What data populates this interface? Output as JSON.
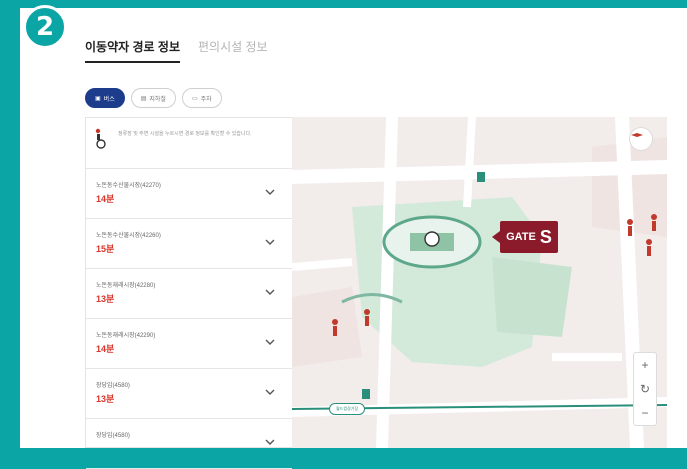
{
  "step_badge": "2",
  "tabs": [
    {
      "label": "이동약자 경로 정보",
      "active": true
    },
    {
      "label": "편의시설 정보",
      "active": false
    }
  ],
  "transport_chips": [
    {
      "label": "버스",
      "icon": "bus-icon",
      "active": true
    },
    {
      "label": "지하철",
      "icon": "subway-icon",
      "active": false
    },
    {
      "label": "주차",
      "icon": "car-icon",
      "active": false
    }
  ],
  "notice": {
    "text": "정류장 및 주변 시설을 누르시면 경로 정보를 확인할 수 있습니다."
  },
  "routes": [
    {
      "name": "노돈동수산물시장(42270)",
      "time": "14분"
    },
    {
      "name": "노돈동수산물시장(42260)",
      "time": "15분"
    },
    {
      "name": "노돈동재래시장(42280)",
      "time": "13분"
    },
    {
      "name": "노돈동재래시장(42290)",
      "time": "14분"
    },
    {
      "name": "장당입(4580)",
      "time": "13분"
    },
    {
      "name": "장당입(4580)",
      "time": ""
    }
  ],
  "map": {
    "gate_label": "GATE",
    "gate_letter": "S",
    "station_label": "월드컵경기장",
    "zoom_in": "+",
    "reset": "↻",
    "zoom_out": "−",
    "colors": {
      "park": "#cfe6d8",
      "road": "#ffffff",
      "gate": "#8b1a2b",
      "accent": "#0aa5a4"
    }
  }
}
